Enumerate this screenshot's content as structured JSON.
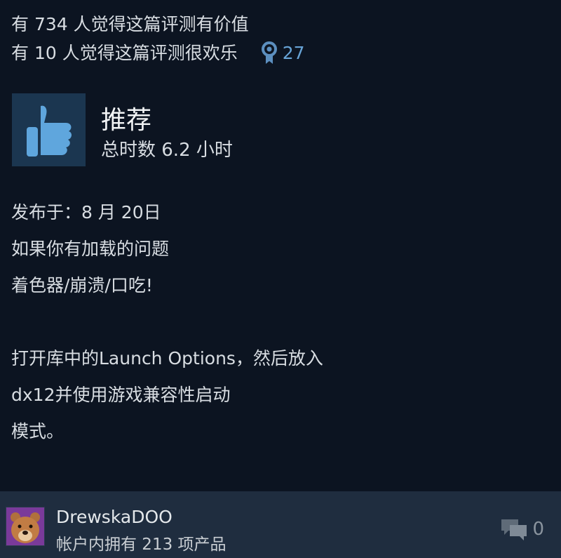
{
  "helpful": {
    "valuable_text": "有 734 人觉得这篇评测有价值",
    "funny_text": "有 10 人觉得这篇评测很欢乐",
    "award_count": "27",
    "award_icon": "award-ribbon-icon"
  },
  "recommendation": {
    "icon": "thumbs-up-icon",
    "title": "推荐",
    "hours": "总时数 6.2 小时"
  },
  "review": {
    "posted": "发布于：8 月 20日",
    "line1": "如果你有加载的问题",
    "line2": "着色器/崩溃/口吃!",
    "line3": "打开库中的Launch Options，然后放入",
    "line4": "dx12并使用游戏兼容性启动",
    "line5": "模式。"
  },
  "author": {
    "name": "DrewskaDOO",
    "products": "帐户内拥有 213 项产品",
    "avatar_icon": "bear-avatar"
  },
  "comments": {
    "icon": "comment-bubble-icon",
    "count": "0"
  },
  "colors": {
    "background": "#0c1421",
    "footer": "#1f2d3f",
    "accent_blue": "#67a3d6",
    "thumb_box": "#1b3650"
  }
}
